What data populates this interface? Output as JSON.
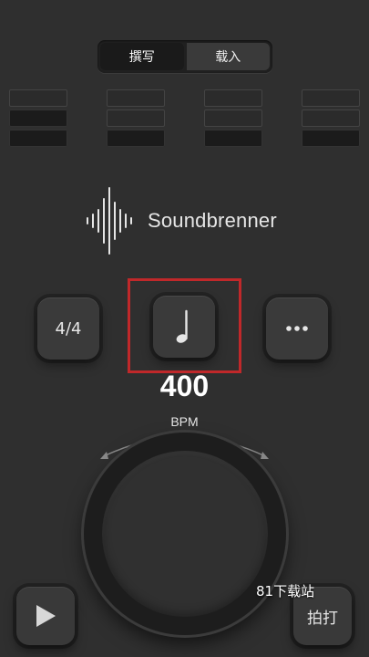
{
  "segment": {
    "write_label": "撰写",
    "load_label": "载入"
  },
  "beats": [
    [
      "off",
      "on",
      "on"
    ],
    [
      "off",
      "off",
      "on"
    ],
    [
      "off",
      "off",
      "on"
    ],
    [
      "off",
      "off",
      "on"
    ]
  ],
  "brand": {
    "name": "Soundbrenner"
  },
  "controls": {
    "time_signature": "4/4",
    "more_icon": "ellipsis-icon",
    "note_icon": "quarter-note-icon"
  },
  "tempo": {
    "value": "400",
    "unit": "BPM"
  },
  "actions": {
    "tap_label": "拍打",
    "play_icon": "play-icon"
  },
  "watermark": "81下载站",
  "colors": {
    "background": "#2f2f2f",
    "highlight": "#c0282a"
  }
}
